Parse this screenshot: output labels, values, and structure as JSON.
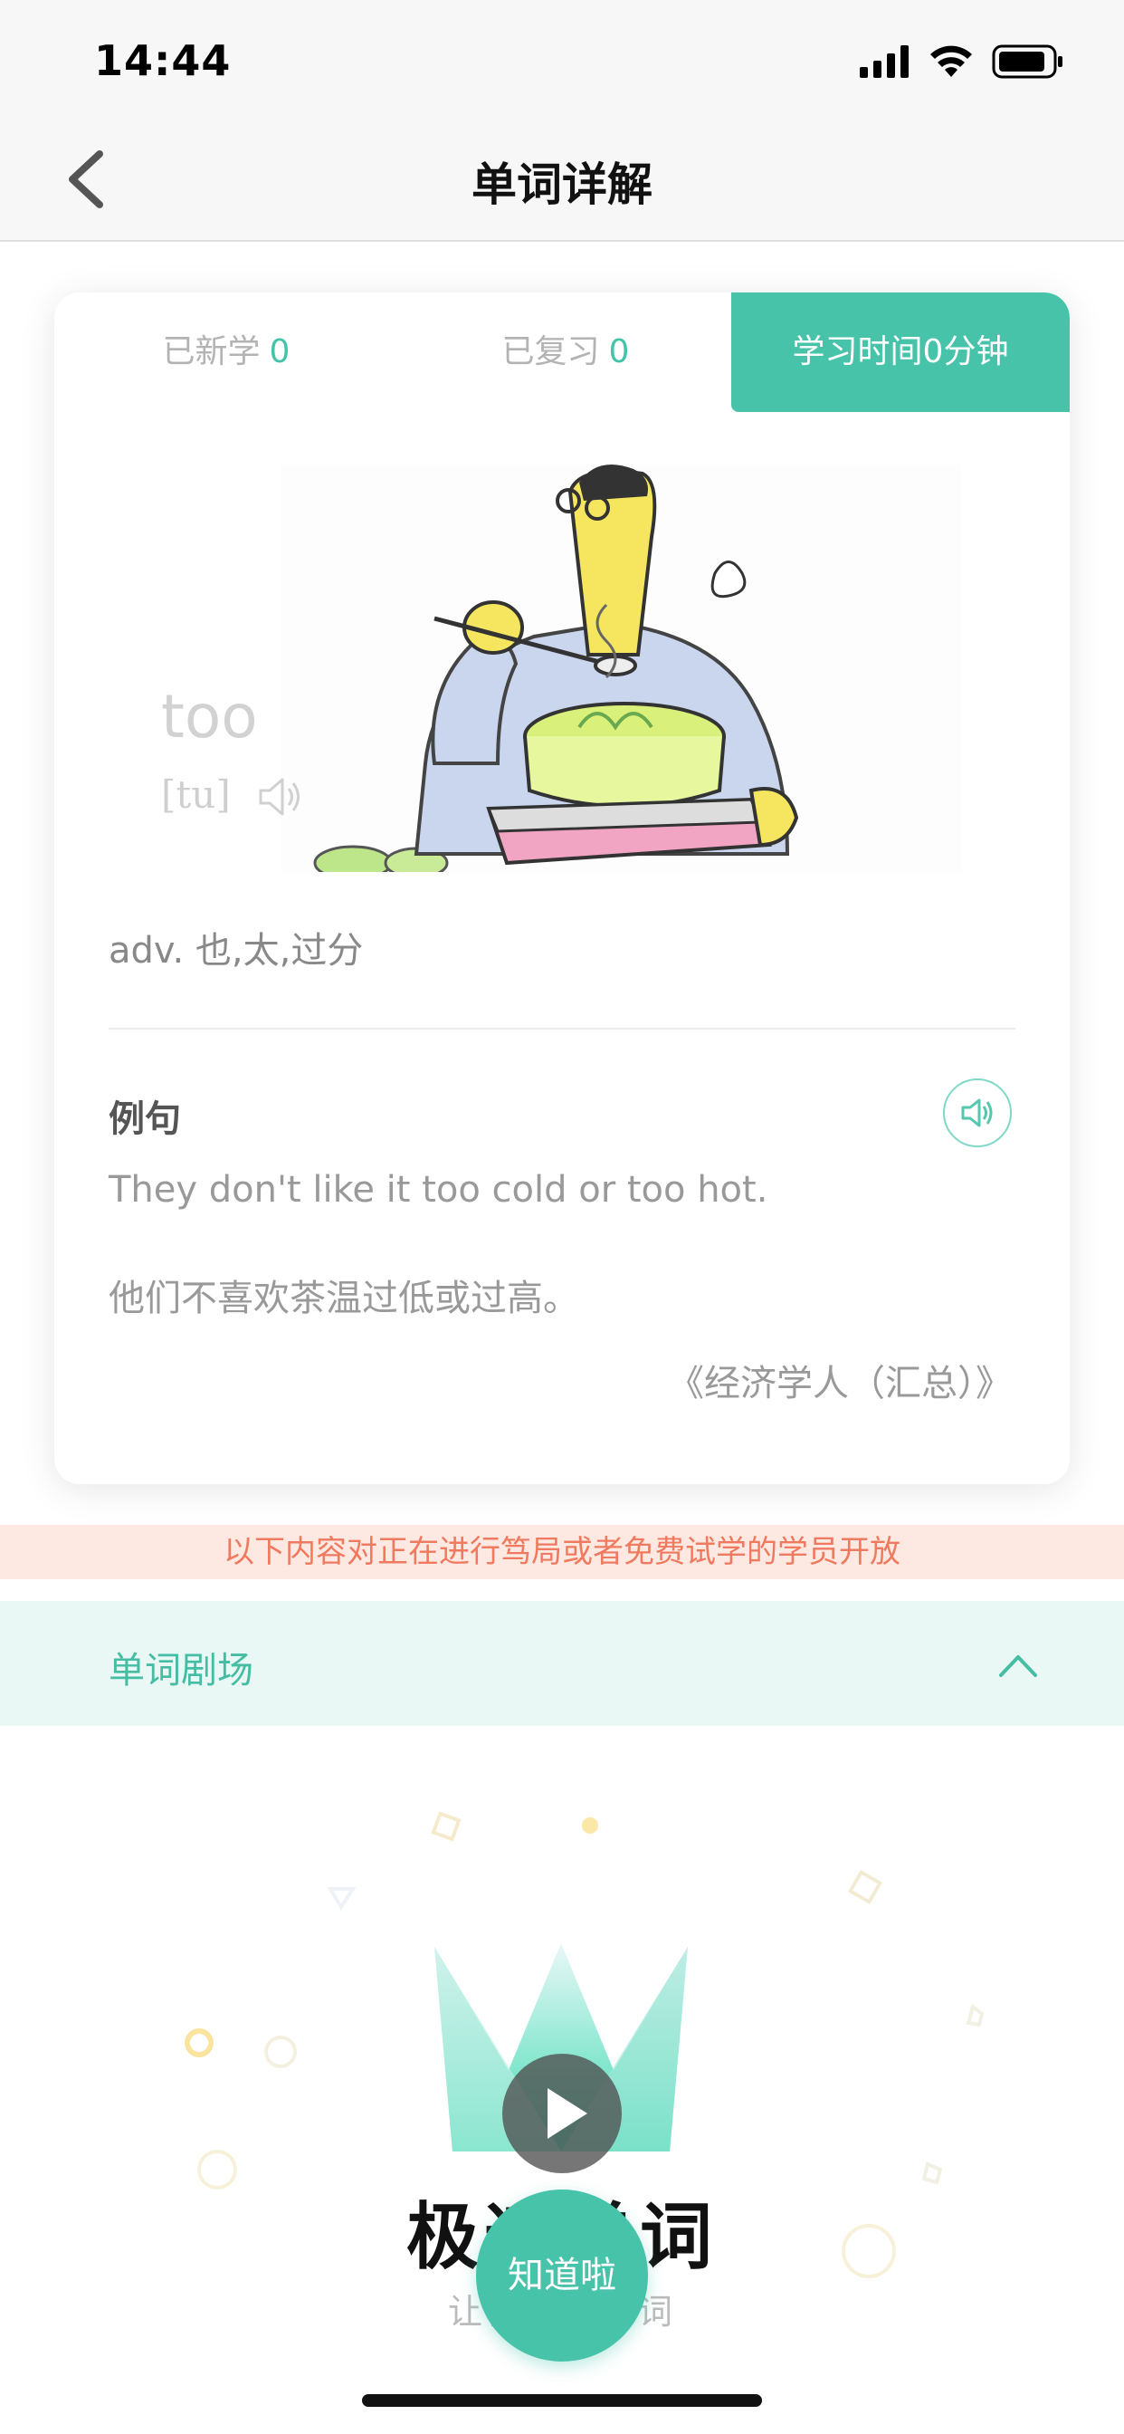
{
  "status_bar": {
    "time": "14:44"
  },
  "nav": {
    "title": "单词详解"
  },
  "stats": {
    "new_label": "已新学",
    "new_count": "0",
    "review_label": "已复习",
    "review_count": "0",
    "study_time": "学习时间0分钟"
  },
  "word": {
    "text": "too",
    "phonetic": "[tu]",
    "definition": "adv. 也,太,过分"
  },
  "example": {
    "title": "例句",
    "english": "They don't like it too cold or too hot.",
    "chinese": "他们不喜欢茶温过低或过高。",
    "source": "《经济学人（汇总）》"
  },
  "notice": "以下内容对正在进行笃局或者免费试学的学员开放",
  "theater": {
    "label": "单词剧场"
  },
  "promo": {
    "title": "极速单词",
    "subtitle": "让你记住单词"
  },
  "know_button": "知道啦",
  "colors": {
    "accent": "#46c3a9",
    "notice_text": "#ef7a5f",
    "notice_bg": "#fde9e2"
  }
}
